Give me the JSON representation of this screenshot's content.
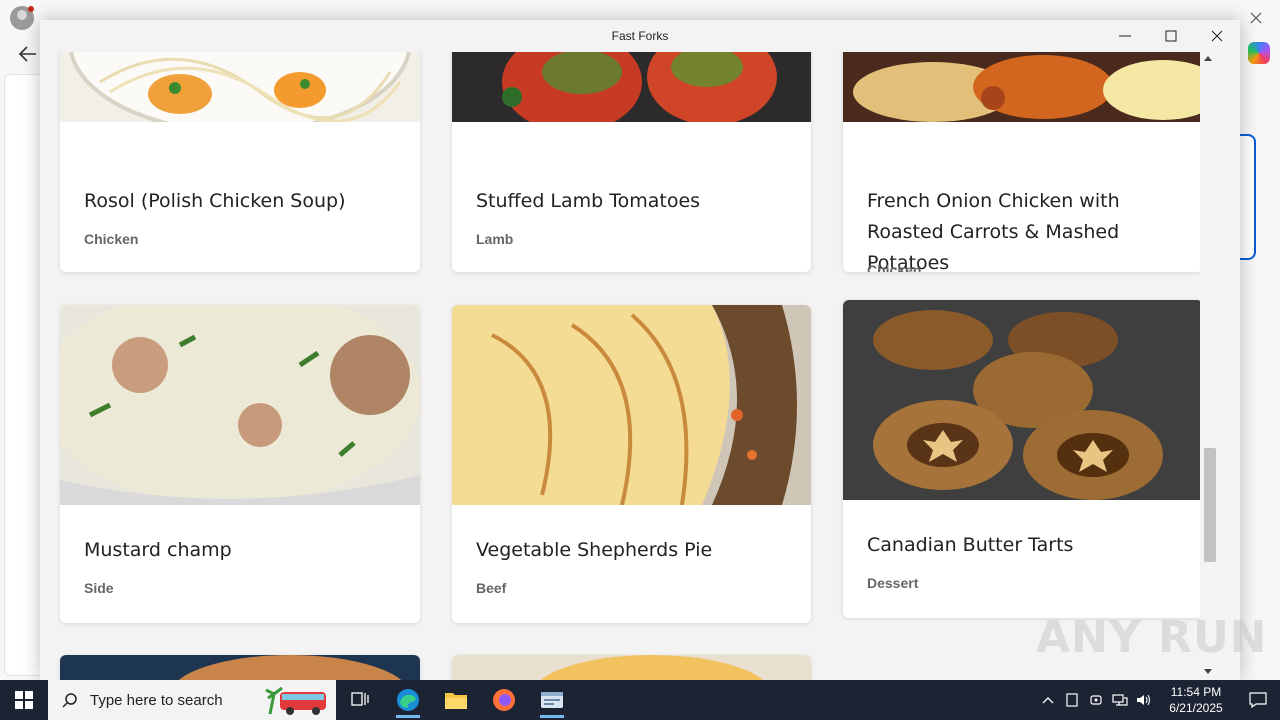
{
  "app": {
    "title": "Fast Forks"
  },
  "recipes": [
    {
      "title": "Rosol (Polish Chicken Soup)",
      "category": "Chicken"
    },
    {
      "title": "Stuffed Lamb Tomatoes",
      "category": "Lamb"
    },
    {
      "title": "French Onion Chicken with Roasted Carrots & Mashed Potatoes",
      "category": "Chicken"
    },
    {
      "title": "Mustard champ",
      "category": "Side"
    },
    {
      "title": "Vegetable Shepherds Pie",
      "category": "Beef"
    },
    {
      "title": "Canadian Butter Tarts",
      "category": "Dessert"
    }
  ],
  "watermark": "ANY RUN",
  "taskbar": {
    "search_placeholder": "Type here to search",
    "time": "11:54 PM",
    "date": "6/21/2025"
  },
  "icons": [
    "windows-start-icon",
    "search-icon",
    "task-view-icon",
    "edge-icon",
    "file-explorer-icon",
    "firefox-icon",
    "app-icon",
    "chevron-up-icon",
    "network-icon",
    "volume-icon",
    "notification-icon"
  ]
}
